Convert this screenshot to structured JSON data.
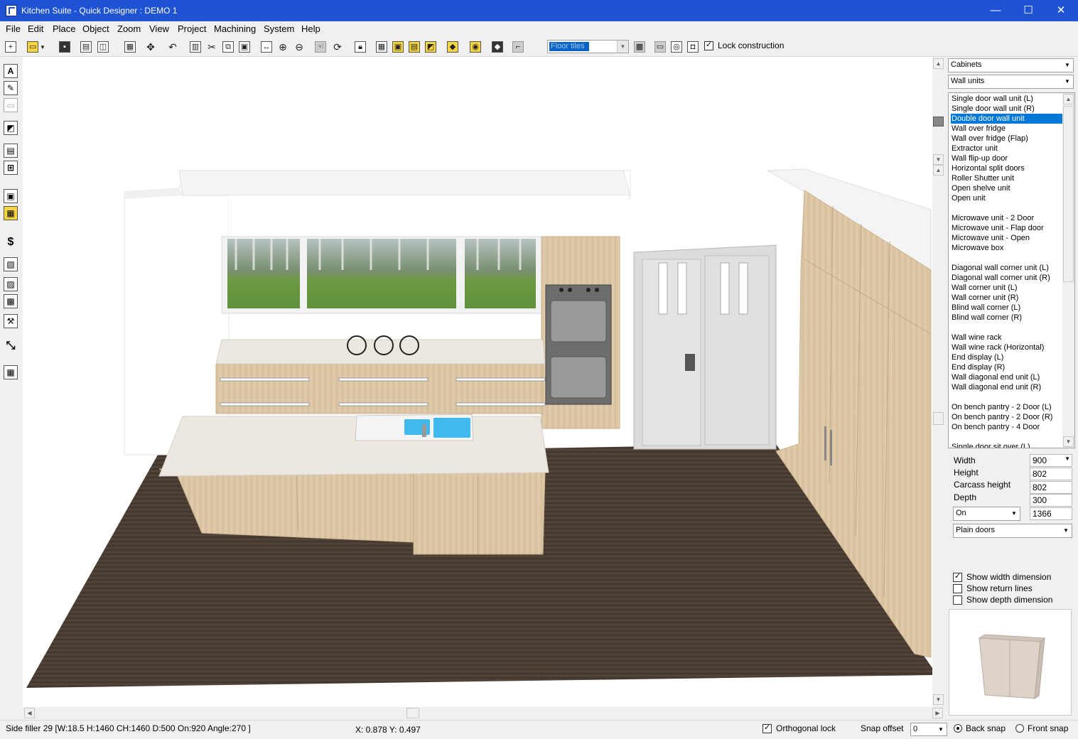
{
  "window": {
    "title": "Kitchen Suite - Quick Designer : DEMO 1",
    "minimize_glyph": "—",
    "maximize_glyph": "☐",
    "close_glyph": "✕"
  },
  "menu": [
    "File",
    "Edit",
    "Place",
    "Object",
    "Zoom",
    "View",
    "Project",
    "Machining",
    "System",
    "Help"
  ],
  "toolbar": {
    "floor_combo_value": "Floor tiles",
    "lock_construction_label": "Lock construction",
    "lock_construction_checked": true
  },
  "left_tools": [
    "A",
    "✎",
    "▭",
    "◩",
    "▤",
    "⊞",
    "▣",
    "▦",
    "$",
    "▧",
    "▨",
    "▩",
    "⚒",
    "⤡",
    "▦"
  ],
  "right_panel": {
    "category": "Cabinets",
    "subcategory": "Wall units",
    "list_items": [
      "Single door wall unit (L)",
      "Single door wall unit (R)",
      "Double door wall unit",
      "Wall over fridge",
      "Wall over fridge (Flap)",
      "Extractor unit",
      "Wall flip-up door",
      "Horizontal split doors",
      "Roller Shutter unit",
      "Open shelve unit",
      "Open unit",
      "",
      "Microwave unit - 2 Door",
      "Microwave unit - Flap door",
      "Microwave unit - Open",
      "Microwave box",
      "",
      "Diagonal wall corner unit (L)",
      "Diagonal wall corner unit (R)",
      "Wall corner unit (L)",
      "Wall corner unit (R)",
      "Blind wall corner (L)",
      "Blind wall corner (R)",
      "",
      "Wall wine rack",
      "Wall wine rack (Horizontal)",
      "End display (L)",
      "End display (R)",
      "Wall diagonal end unit (L)",
      "Wall diagonal end unit (R)",
      "",
      "On bench pantry - 2 Door (L)",
      "On bench pantry - 2 Door (R)",
      "On bench pantry - 4 Door",
      "",
      "Single door sit over (L)"
    ],
    "selected_index": 2,
    "properties": {
      "width_label": "Width",
      "width_value": "900",
      "height_label": "Height",
      "height_value": "802",
      "carcass_label": "Carcass height",
      "carcass_value": "802",
      "depth_label": "Depth",
      "depth_value": "300",
      "on_value": "On",
      "on_number": "1366",
      "door_style": "Plain doors"
    },
    "checks": [
      {
        "label": "Show width dimension",
        "checked": true
      },
      {
        "label": "Show return lines",
        "checked": false
      },
      {
        "label": "Show depth dimension",
        "checked": false
      }
    ]
  },
  "status": {
    "object_info": "Side filler 29 [W:18.5  H:1460  CH:1460  D:500  On:920  Angle:270 ]",
    "coords": "X: 0.878   Y: 0.497",
    "ortho_label": "Orthogonal lock",
    "ortho_checked": true,
    "snap_offset_label": "Snap offset",
    "snap_offset_value": "0",
    "back_snap_label": "Back snap",
    "front_snap_label": "Front snap",
    "back_snap_selected": true
  },
  "colors": {
    "titlebar": "#1e53d3",
    "selection": "#0078d7",
    "floor": "#4a3d33",
    "wood": "#dcc6a4",
    "benchtop": "#ece8e0",
    "sink": "#3fb9ee"
  }
}
